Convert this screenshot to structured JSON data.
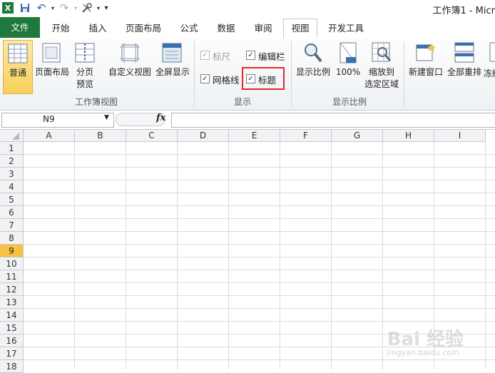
{
  "window": {
    "title": "工作簿1 - Micr"
  },
  "qat": {
    "undo": "↶",
    "redo": "↷",
    "more": "▾"
  },
  "tabs": [
    {
      "label": "文件"
    },
    {
      "label": "开始"
    },
    {
      "label": "插入"
    },
    {
      "label": "页面布局"
    },
    {
      "label": "公式"
    },
    {
      "label": "数据"
    },
    {
      "label": "审阅"
    },
    {
      "label": "视图"
    },
    {
      "label": "开发工具"
    }
  ],
  "ribbon": {
    "workbook_views": {
      "normal": "普通",
      "page_layout": "页面布局",
      "page_break_1": "分页",
      "page_break_2": "预览",
      "custom_views": "自定义视图",
      "full_screen": "全屏显示",
      "group_label": "工作簿视图"
    },
    "show": {
      "ruler": "标尺",
      "formula_bar": "编辑栏",
      "gridlines": "网格线",
      "headings": "标题",
      "group_label": "显示",
      "check": "✓"
    },
    "zoom": {
      "zoom": "显示比例",
      "hundred": "100%",
      "zoom_sel_1": "缩放到",
      "zoom_sel_2": "选定区域",
      "group_label": "显示比例"
    },
    "window": {
      "new_window": "新建窗口",
      "arrange_all": "全部重排",
      "freeze": "冻结"
    }
  },
  "formula_bar": {
    "name_box": "N9",
    "fx": "fx"
  },
  "columns": [
    "A",
    "B",
    "C",
    "D",
    "E",
    "F",
    "G",
    "H",
    "I"
  ],
  "rows": [
    "1",
    "2",
    "3",
    "4",
    "5",
    "6",
    "7",
    "8",
    "9",
    "10",
    "11",
    "12",
    "13",
    "14",
    "15",
    "16",
    "17",
    "18"
  ],
  "selected_row": "9",
  "watermark": {
    "main": "Bai 经验",
    "sub": "jingyan.baidu.com"
  },
  "colors": {
    "file_tab": "#1d7a3a",
    "selected_header": "#f5c243",
    "highlight": "#e2262b"
  }
}
